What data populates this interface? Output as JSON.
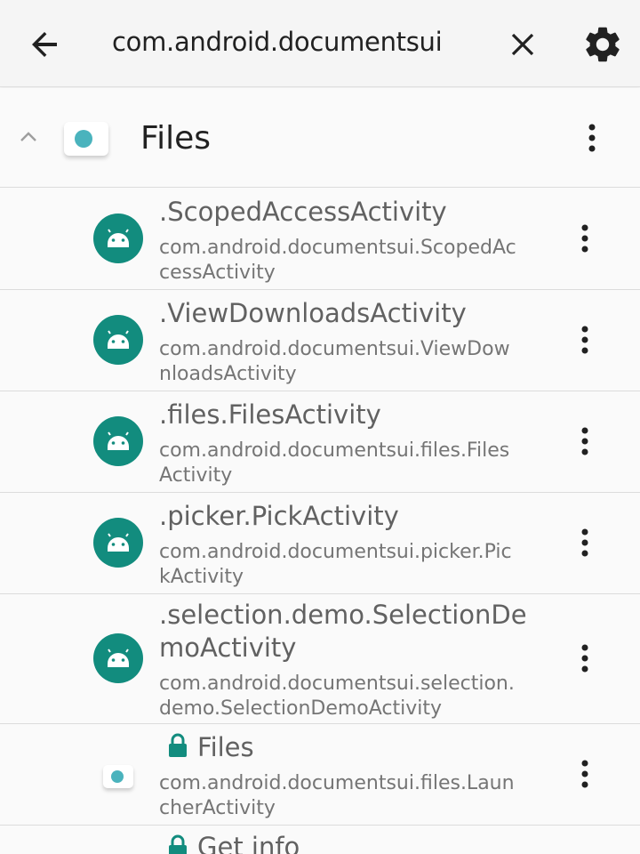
{
  "header": {
    "search_value": "com.android.documentsui",
    "icons": {
      "back": "arrow-back-icon",
      "clear": "close-icon",
      "settings": "gear-icon"
    }
  },
  "group": {
    "title": "Files",
    "icons": {
      "collapse": "chevron-up-icon",
      "menu": "more-vert-icon"
    }
  },
  "activities": [
    {
      "title": ".ScopedAccessActivity",
      "sub_line1": "com.android.documentsui.ScopedAc",
      "sub_line2": "cessActivity"
    },
    {
      "title": ".ViewDownloadsActivity",
      "sub_line1": "com.android.documentsui.ViewDow",
      "sub_line2": "nloadsActivity"
    },
    {
      "title": ".files.FilesActivity",
      "sub_line1": "com.android.documentsui.files.Files",
      "sub_line2": "Activity"
    },
    {
      "title": ".picker.PickActivity",
      "sub_line1": "com.android.documentsui.picker.Pic",
      "sub_line2": "kActivity"
    },
    {
      "title_line1": ".selection.demo.SelectionDe",
      "title_line2": "moActivity",
      "sub_line1": "com.android.documentsui.selection.",
      "sub_line2": "demo.SelectionDemoActivity"
    }
  ],
  "launchers": [
    {
      "title": "Files",
      "sub_line1": "com.android.documentsui.files.Laun",
      "sub_line2": "cherActivity"
    },
    {
      "title": "Get info"
    }
  ],
  "colors": {
    "accent": "#128c7e",
    "app_dot": "#4ab3bd"
  }
}
